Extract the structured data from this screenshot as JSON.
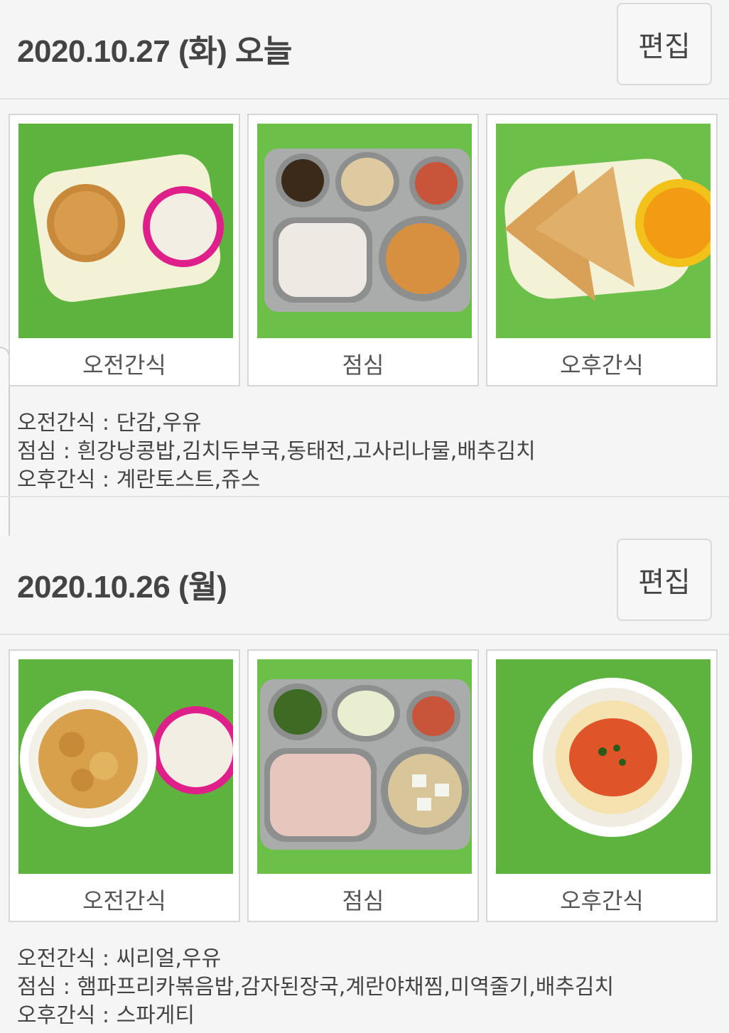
{
  "days": [
    {
      "date_title": "2020.10.27 (화) 오늘",
      "edit_label": "편집",
      "meals": [
        {
          "caption": "오전간식",
          "photo": "morning-snack-photo-bread-milk"
        },
        {
          "caption": "점심",
          "photo": "lunch-photo-tray"
        },
        {
          "caption": "오후간식",
          "photo": "afternoon-snack-photo-french-toast-juice"
        }
      ],
      "menu_lines": [
        "오전간식 : 단감,우유",
        "점심 : 흰강낭콩밥,김치두부국,동태전,고사리나물,배추김치",
        "오후간식 : 계란토스트,쥬스"
      ]
    },
    {
      "date_title": "2020.10.26 (월)",
      "edit_label": "편집",
      "meals": [
        {
          "caption": "오전간식",
          "photo": "morning-snack-photo-cereal-milk"
        },
        {
          "caption": "점심",
          "photo": "lunch-photo-tray"
        },
        {
          "caption": "오후간식",
          "photo": "afternoon-snack-photo-spaghetti"
        }
      ],
      "menu_lines": [
        "오전간식 : 씨리얼,우유",
        "점심 : 햄파프리카볶음밥,감자된장국,계란야채찜,미역줄기,배추김치",
        "오후간식 : 스파게티"
      ]
    }
  ]
}
